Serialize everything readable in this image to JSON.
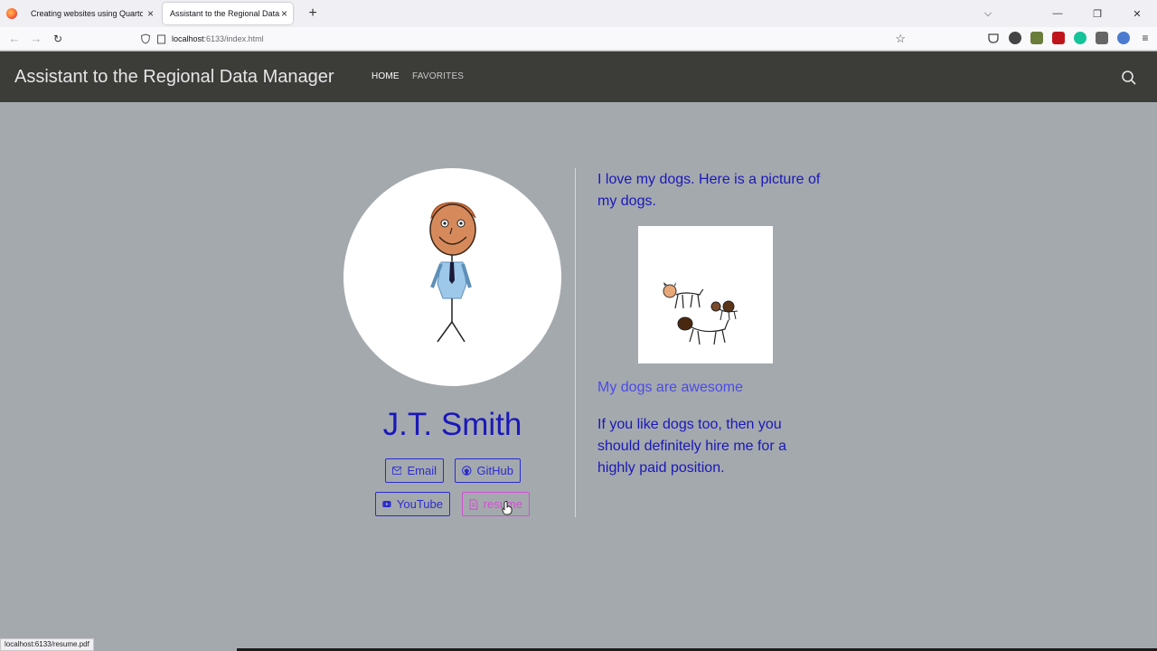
{
  "browser": {
    "tabs": [
      {
        "title": "Creating websites using Quarto and"
      },
      {
        "title": "Assistant to the Regional Data Mana"
      }
    ],
    "url_host": "localhost",
    "url_path": ":6133/index.html",
    "status_text": "localhost:6133/resume.pdf"
  },
  "site": {
    "title": "Assistant to the Regional Data Manager",
    "nav": {
      "home": "HOME",
      "favorites": "FAVORITES"
    }
  },
  "profile": {
    "name": "J.T. Smith",
    "links": {
      "email": "Email",
      "github": "GitHub",
      "youtube": "YouTube",
      "resume": "resume"
    }
  },
  "content": {
    "intro": "I love my dogs. Here is a picture of my dogs.",
    "dogs_link": "My dogs are awesome",
    "outro": "If you like dogs too, then you should definitely hire me for a highly paid position."
  },
  "colors": {
    "page_bg": "#a4a9ae",
    "nav_bg": "#3c3c39",
    "text_blue": "#1a18b8",
    "link_blue": "#4b4be6",
    "hover_pink": "#d24fd2"
  }
}
